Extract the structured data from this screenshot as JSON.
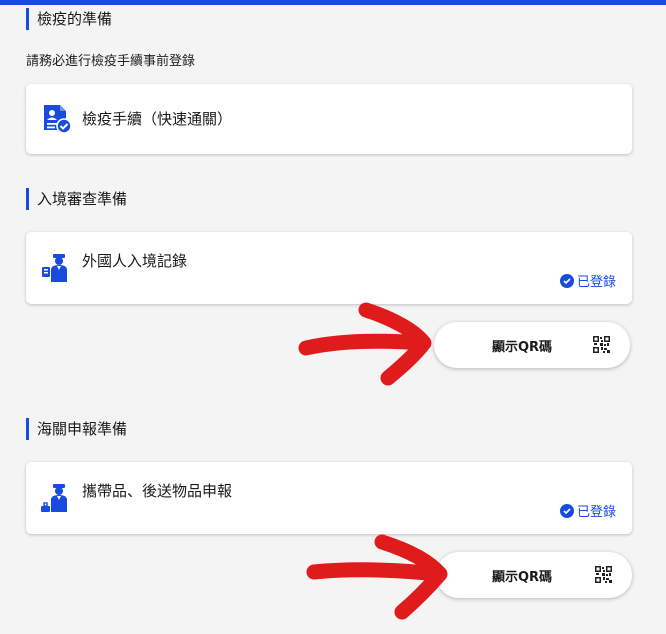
{
  "sections": {
    "quarantine": {
      "title": "檢疫的準備",
      "subtext": "請務必進行檢疫手續事前登錄",
      "card_label": "檢疫手續（快速通關）"
    },
    "immigration": {
      "title": "入境審查準備",
      "card_label": "外國人入境記錄",
      "status": "已登錄",
      "qr_button": "顯示QR碼"
    },
    "customs": {
      "title": "海關申報準備",
      "card_label": "攜帶品、後送物品申報",
      "status": "已登錄",
      "qr_button": "顯示QR碼"
    }
  },
  "colors": {
    "accent": "#1a4be0",
    "annotation_arrow": "#e01b1b"
  },
  "icons": {
    "quarantine": "document-check-icon",
    "immigration": "immigration-officer-icon",
    "customs": "customs-officer-icon",
    "status": "check-circle-icon",
    "qr": "qr-code-icon"
  }
}
